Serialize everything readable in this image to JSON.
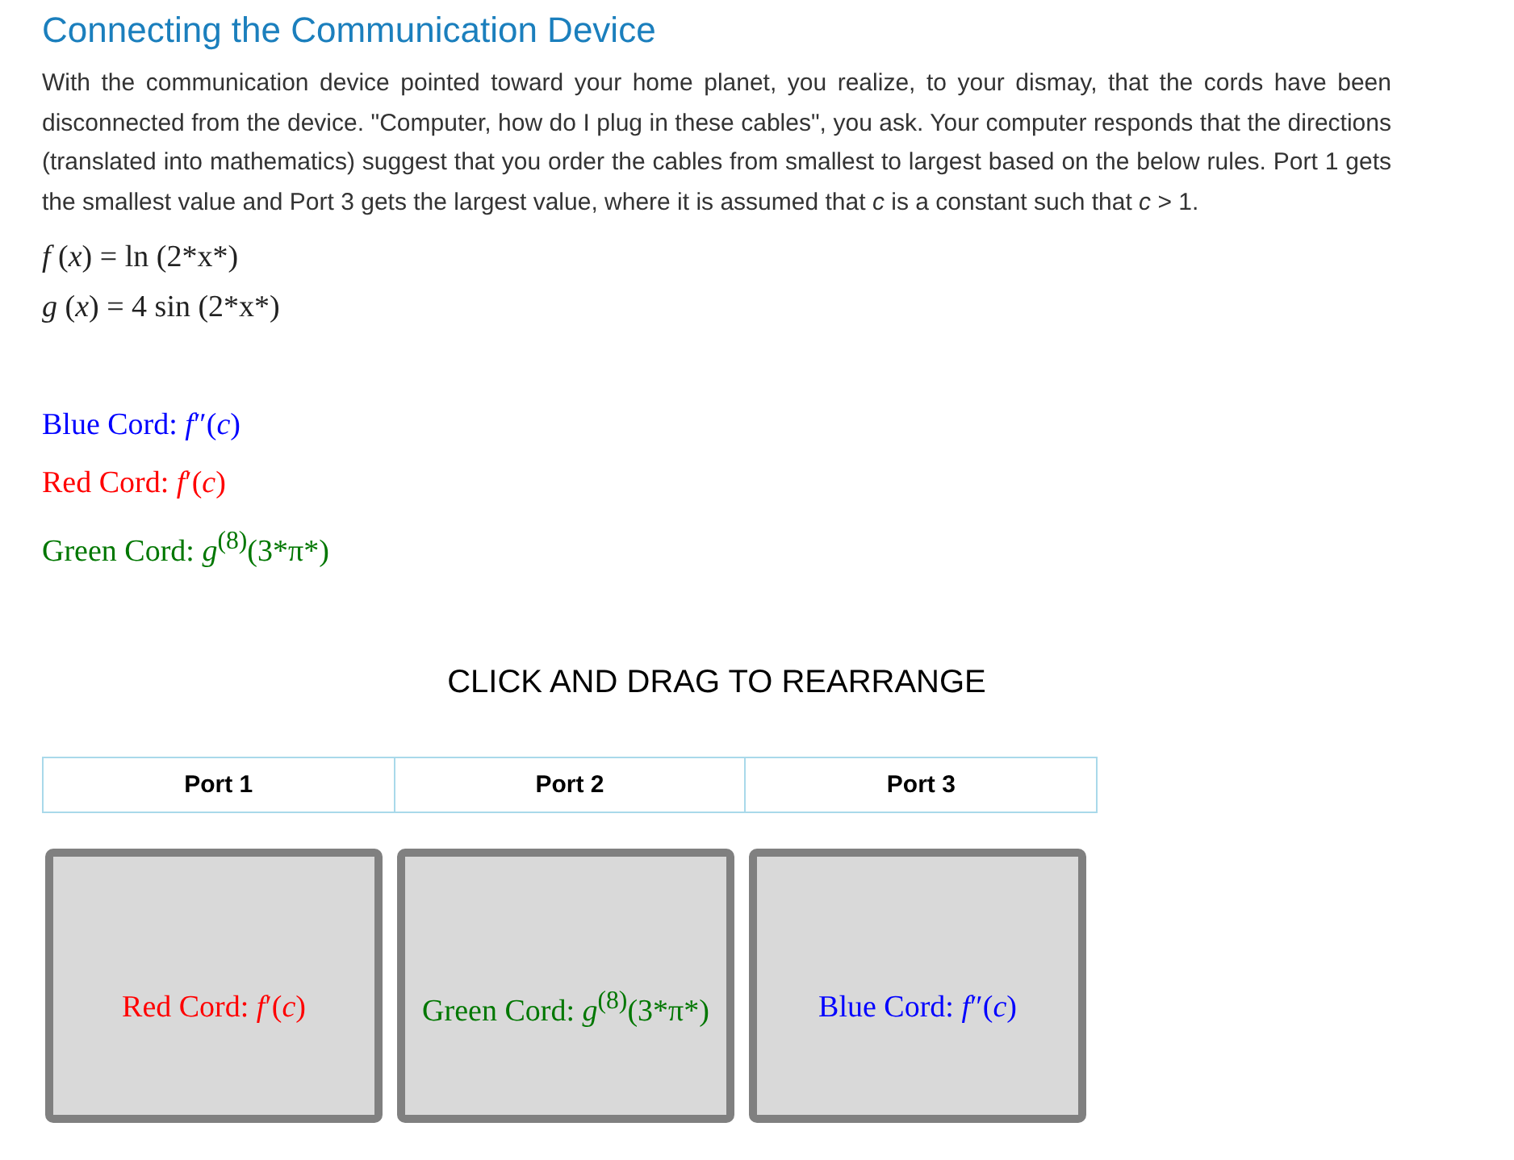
{
  "title": "Connecting the Communication Device",
  "intro": "With the communication device pointed toward your home planet, you realize, to your dismay, that the cords have been disconnected from the device. \"Computer, how do I plug in these cables\", you ask. Your computer responds that the directions (translated into mathematics) suggest that you order the cables from smallest to largest based on the below rules. Port 1 gets the smallest value and Port 3 gets the largest value, where it is assumed that *c* is a constant such that *c* > 1.",
  "equations": [
    "*f* (*x*) = ln (2*x*)",
    "*g* (*x*) = 4 sin (2*x*)"
  ],
  "cords": [
    {
      "label": "Blue Cord: *f*″(*c*)",
      "color": "#0000ff"
    },
    {
      "label": "Red Cord: *f*′(*c*)",
      "color": "#ff0000"
    },
    {
      "label": "Green Cord: *g*$^{(8)}$(3*π*)",
      "color": "#007700"
    }
  ],
  "instruction": "CLICK AND DRAG TO REARRANGE",
  "ports": [
    "Port 1",
    "Port 2",
    "Port 3"
  ],
  "slots": [
    {
      "label": "Red Cord: *f*′(*c*)",
      "color": "#ff0000"
    },
    {
      "label": "Green Cord: *g*$^{(8)}$(3*π*)",
      "color": "#007700"
    },
    {
      "label": "Blue Cord: *f*″(*c*)",
      "color": "#0000ff"
    }
  ]
}
